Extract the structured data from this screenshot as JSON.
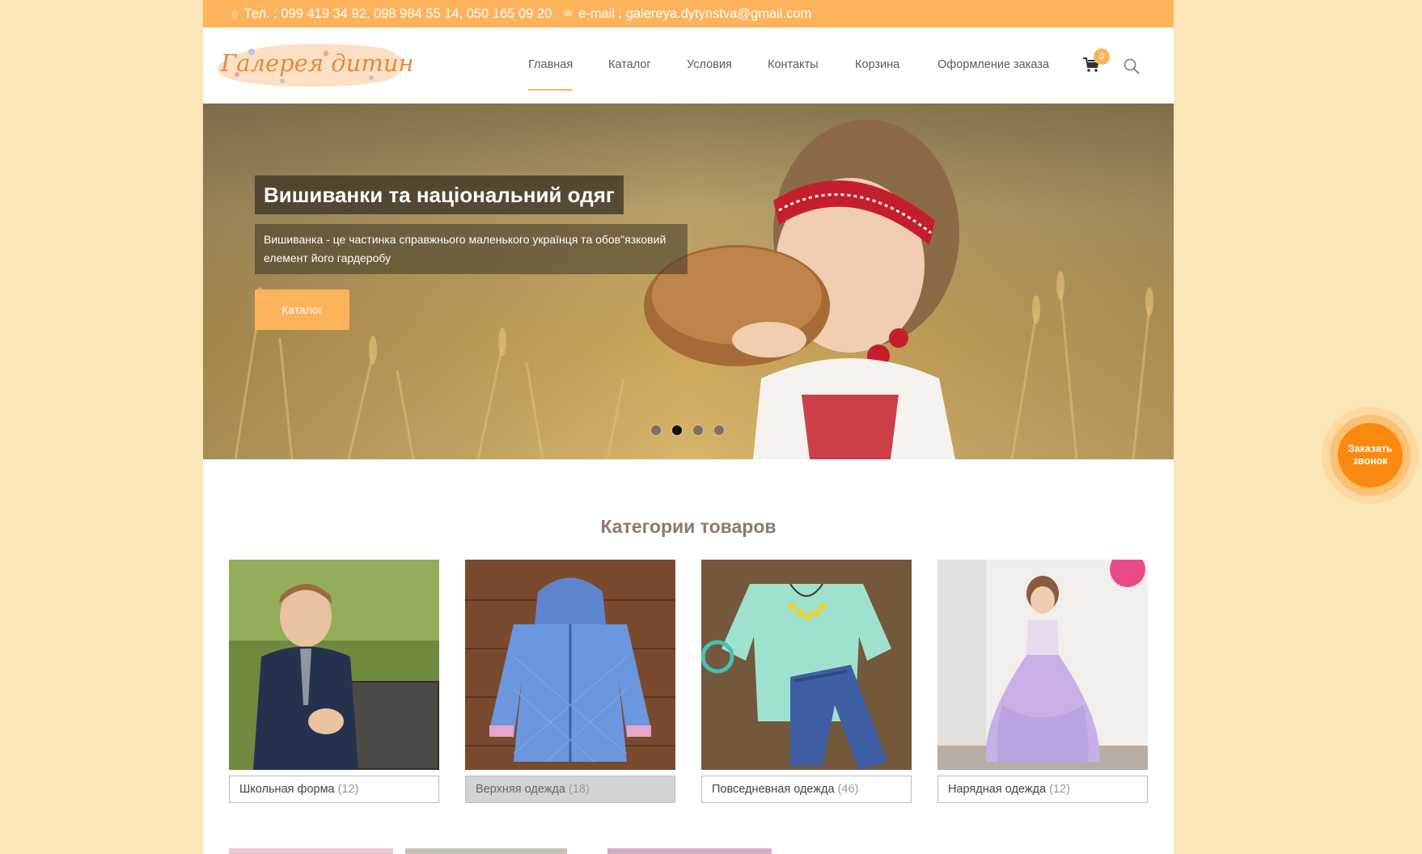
{
  "topbar": {
    "phone": "Тел. : 099 419 34 92, 098 984 55 14, 050 165 09 20",
    "email": "e-mail : galereya.dytynstva@gmail.com"
  },
  "header": {
    "logo_text": "Галерея дитинства",
    "nav": [
      {
        "label": "Главная",
        "active": true
      },
      {
        "label": "Каталог"
      },
      {
        "label": "Условия"
      },
      {
        "label": "Контакты"
      },
      {
        "label": "Корзина"
      },
      {
        "label": "Оформление заказа"
      }
    ],
    "cart_count": "0"
  },
  "hero": {
    "title": "Вишиванки та національний одяг",
    "text": "Вишиванка - це частинка справжнього маленького українця та обов\"язковий елемент його гардеробу",
    "button": "Каталог",
    "slides_count": 4,
    "active_slide": 2
  },
  "categories": {
    "title": "Категории товаров",
    "items": [
      {
        "name": "Школьная форма",
        "count": "(12)"
      },
      {
        "name": "Верхняя одежда",
        "count": "(18)"
      },
      {
        "name": "Повседневная одежда",
        "count": "(46)"
      },
      {
        "name": "Нарядная одежда",
        "count": "(12)"
      }
    ]
  },
  "callback": {
    "label": "Заказать звонок"
  },
  "colors": {
    "accent": "#fdb35c",
    "background": "#fbe6b8",
    "callback": "#f98a0f"
  }
}
